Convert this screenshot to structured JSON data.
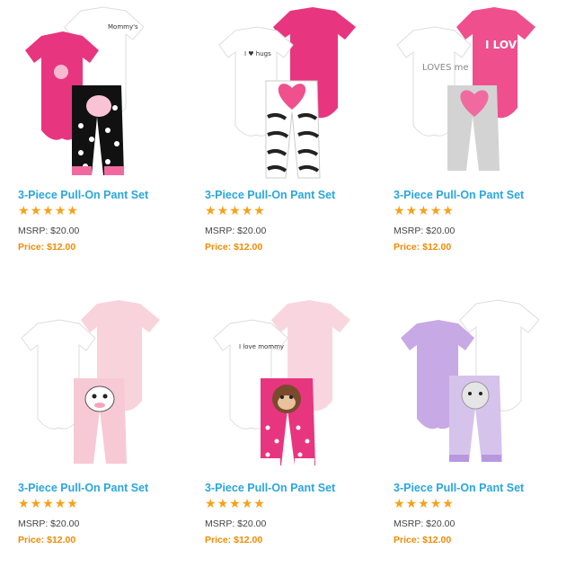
{
  "products": [
    {
      "title": "3-Piece Pull-On Pant Set",
      "rating": 5,
      "msrp": "MSRP: $20.00",
      "price": "Price: $12.00",
      "colors": {
        "body1": "#e8357f",
        "body2": "#ffffff",
        "pants": "#111111",
        "accent": "#ffffff"
      },
      "print": {
        "back": "Mommy's",
        "pants": "dots"
      }
    },
    {
      "title": "3-Piece Pull-On Pant Set",
      "rating": 5,
      "msrp": "MSRP: $20.00",
      "price": "Price: $12.00",
      "colors": {
        "body1": "#ffffff",
        "body2": "#e8357f",
        "pants": "#222222",
        "accent": "#e8357f"
      },
      "print": {
        "front": "I ♥ hugs",
        "pants": "zebra"
      }
    },
    {
      "title": "3-Piece Pull-On Pant Set",
      "rating": 5,
      "msrp": "MSRP: $20.00",
      "price": "Price: $12.00",
      "colors": {
        "body1": "#ffffff",
        "body2": "#ef4f8d",
        "pants": "#cfcfcf",
        "accent": "#ef6f9f"
      },
      "print": {
        "front": "LOVES me",
        "back": "I LOVE",
        "pants": "heart"
      }
    },
    {
      "title": "3-Piece Pull-On Pant Set",
      "rating": 5,
      "msrp": "MSRP: $20.00",
      "price": "Price: $12.00",
      "colors": {
        "body1": "#ffffff",
        "body2": "#f8d3dc",
        "pants": "#f7c9d5",
        "accent": "#e8357f"
      },
      "print": {
        "pants": "zebra-face"
      }
    },
    {
      "title": "3-Piece Pull-On Pant Set",
      "rating": 5,
      "msrp": "MSRP: $20.00",
      "price": "Price: $12.00",
      "colors": {
        "body1": "#ffffff",
        "body2": "#f9d6df",
        "pants": "#e8357f",
        "accent": "#e8357f"
      },
      "print": {
        "front": "I love mommy",
        "pants": "monkey"
      }
    },
    {
      "title": "3-Piece Pull-On Pant Set",
      "rating": 5,
      "msrp": "MSRP: $20.00",
      "price": "Price: $12.00",
      "colors": {
        "body1": "#c7a9e6",
        "body2": "#ffffff",
        "pants": "#d6c3ec",
        "accent": "#9a7cc9"
      },
      "print": {
        "pants": "kitten"
      }
    }
  ]
}
